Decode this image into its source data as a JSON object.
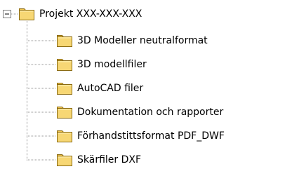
{
  "tree": {
    "root": {
      "label": "Projekt XXX-XXX-XXX",
      "icon": "folder-icon",
      "expanded": true,
      "expander_icon": "minus-box-icon"
    },
    "children": [
      {
        "label": "3D Modeller neutralformat",
        "icon": "folder-icon"
      },
      {
        "label": "3D modellfiler",
        "icon": "folder-icon"
      },
      {
        "label": "AutoCAD filer",
        "icon": "folder-icon"
      },
      {
        "label": "Dokumentation och rapporter",
        "icon": "folder-icon"
      },
      {
        "label": "Förhandstittsformat PDF_DWF",
        "icon": "folder-icon"
      },
      {
        "label": "Skärfiler DXF",
        "icon": "folder-icon"
      }
    ]
  },
  "colors": {
    "folder_fill": "#F7D774",
    "folder_tab": "#F3C64E",
    "folder_outline": "#8A6A12",
    "connector": "#9A9A9A",
    "expander_border": "#7F7F7F"
  }
}
